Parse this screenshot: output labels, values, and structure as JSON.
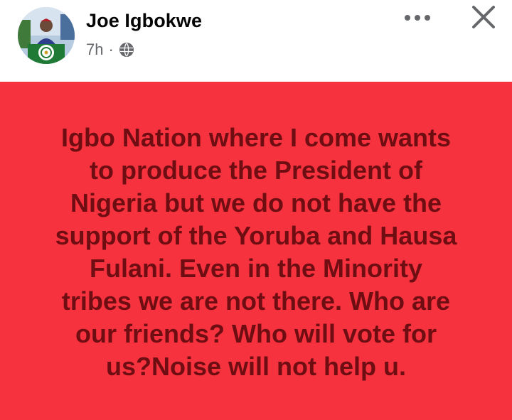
{
  "post": {
    "author": "Joe Igbokwe",
    "time": "7h",
    "separator": "·",
    "audience_icon": "globe-icon",
    "avatar_icon": "profile-photo",
    "text": "Igbo Nation where I come wants\nto produce the President of\nNigeria but we do not have the\nsupport of the Yoruba and Hausa\nFulani. Even in the Minority\ntribes we are not there. Who are\nour friends? Who will vote for\nus?Noise will not help u.",
    "background_color": "#f7323f",
    "text_color": "#6e0d12"
  },
  "actions": {
    "more_icon": "more-options-icon",
    "close_icon": "close-icon"
  }
}
